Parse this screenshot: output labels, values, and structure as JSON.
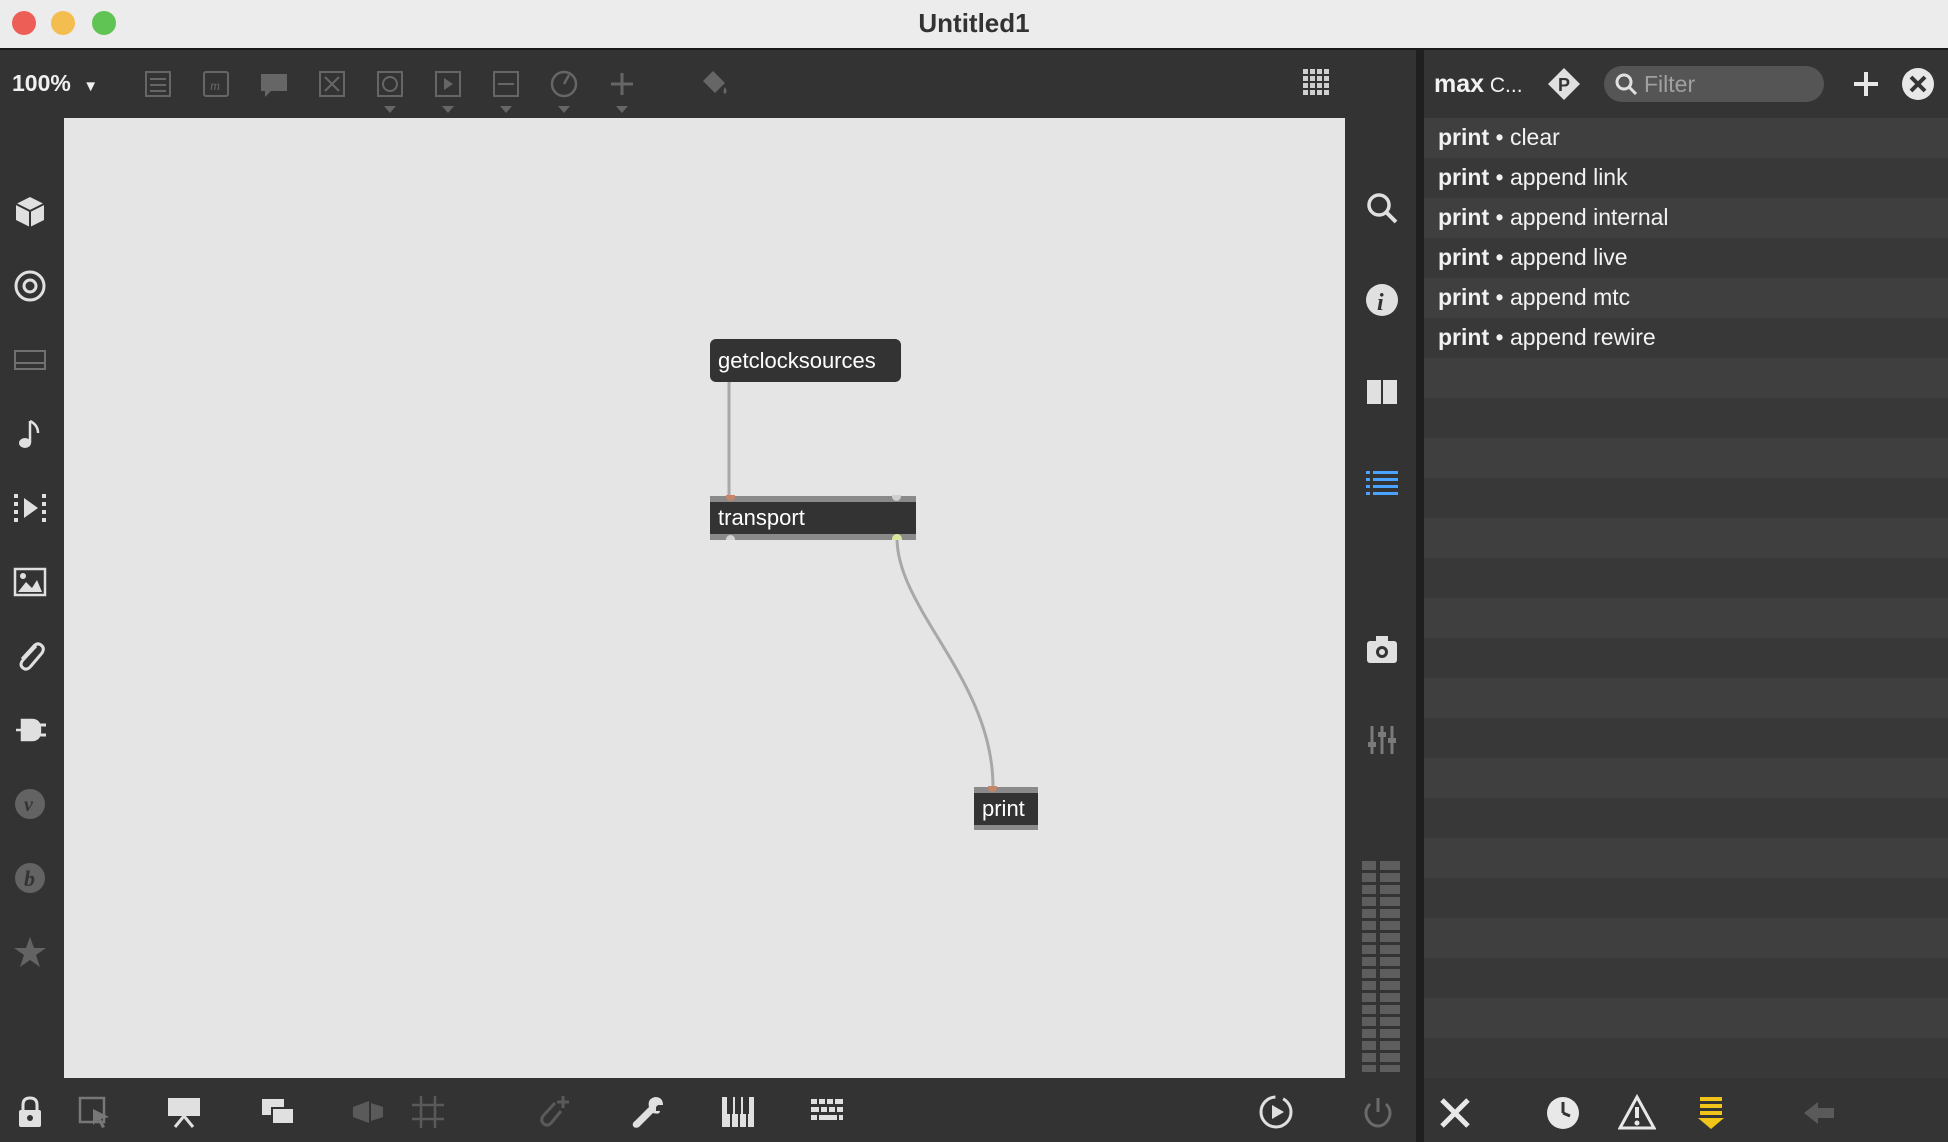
{
  "window": {
    "title": "Untitled1"
  },
  "toolbar": {
    "zoom": "100%"
  },
  "patch": {
    "message": "getclocksources",
    "object_transport": "transport",
    "object_print": "print"
  },
  "console": {
    "title_bold": "max",
    "title_rest": " C...",
    "filter_placeholder": "Filter",
    "messages": [
      {
        "source": "print",
        "text": " • clear"
      },
      {
        "source": "print",
        "text": " • append link"
      },
      {
        "source": "print",
        "text": " • append internal"
      },
      {
        "source": "print",
        "text": " • append live"
      },
      {
        "source": "print",
        "text": " • append mtc"
      },
      {
        "source": "print",
        "text": " • append rewire"
      }
    ]
  },
  "colors": {
    "close": "#ed5f56",
    "minimize": "#f4bd4f",
    "maximize": "#5fc454",
    "accent_blue": "#4aa3ff",
    "accent_yellow": "#f0c419"
  }
}
